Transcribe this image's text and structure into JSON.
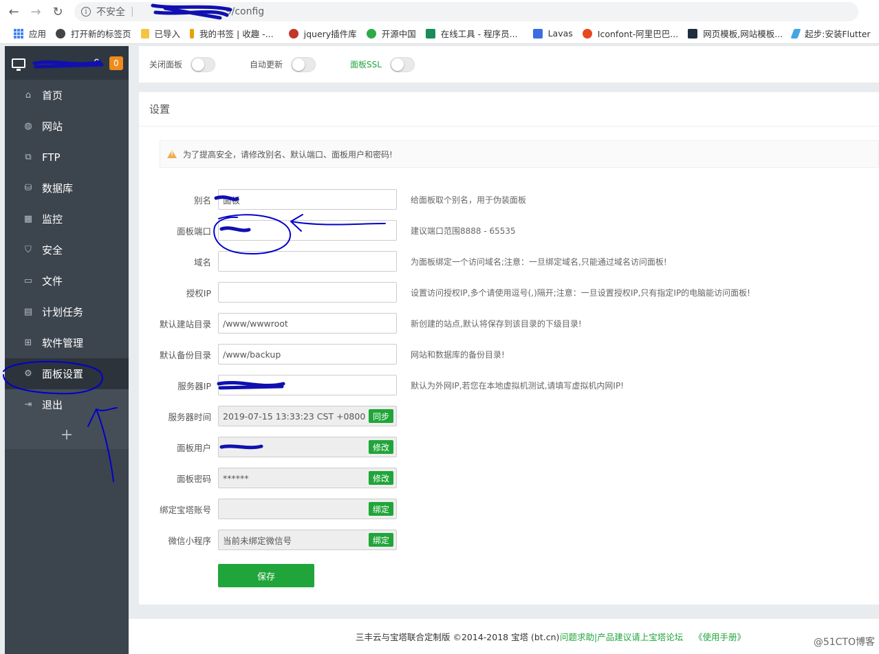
{
  "browser": {
    "security_label": "不安全",
    "separator": "|",
    "path": "9/config",
    "back_label": "←",
    "forward_label": "→",
    "reload_label": "↻",
    "info_label": "i"
  },
  "bookmarks": [
    {
      "label": "应用"
    },
    {
      "label": "打开新的标签页"
    },
    {
      "label": "已导入"
    },
    {
      "label": "我的书签 | 收趣 -..."
    },
    {
      "label": "jquery插件库"
    },
    {
      "label": "开源中国"
    },
    {
      "label": "在线工具 - 程序员..."
    },
    {
      "label": "Lavas"
    },
    {
      "label": "Iconfont-阿里巴巴..."
    },
    {
      "label": "网页模板,网站模板..."
    },
    {
      "label": "起步:安装Flutter"
    }
  ],
  "sidebar": {
    "server_suffix": "0",
    "badge": "0",
    "items": [
      {
        "label": "首页",
        "icon": "home-icon",
        "glyph": "⌂"
      },
      {
        "label": "网站",
        "icon": "globe-icon",
        "glyph": "◍"
      },
      {
        "label": "FTP",
        "icon": "ftp-icon",
        "glyph": "⧉"
      },
      {
        "label": "数据库",
        "icon": "database-icon",
        "glyph": "⛁"
      },
      {
        "label": "监控",
        "icon": "monitor-icon",
        "glyph": "▦"
      },
      {
        "label": "安全",
        "icon": "shield-icon",
        "glyph": "⛉"
      },
      {
        "label": "文件",
        "icon": "folder-icon",
        "glyph": "▭"
      },
      {
        "label": "计划任务",
        "icon": "calendar-icon",
        "glyph": "▤"
      },
      {
        "label": "软件管理",
        "icon": "apps-icon",
        "glyph": "⊞"
      },
      {
        "label": "面板设置",
        "icon": "gear-icon",
        "glyph": "⚙"
      },
      {
        "label": "退出",
        "icon": "logout-icon",
        "glyph": "⇥"
      }
    ],
    "add_label": "+"
  },
  "topbar": {
    "close_panel": "关闭面板",
    "auto_update": "自动更新",
    "panel_ssl": "面板SSL"
  },
  "panel": {
    "title": "设置",
    "alert": "为了提高安全，请修改别名、默认端口、面板用户和密码!",
    "alert_mark": "!",
    "rows": [
      {
        "label": "别名",
        "value": "面板",
        "tip": "给面板取个别名，用于伪装面板"
      },
      {
        "label": "面板端口",
        "value": "",
        "tip": "建议端口范围8888 - 65535"
      },
      {
        "label": "域名",
        "value": "",
        "tip": "为面板绑定一个访问域名;注意：一旦绑定域名,只能通过域名访问面板!"
      },
      {
        "label": "授权IP",
        "value": "",
        "tip": "设置访问授权IP,多个请使用逗号(,)隔开;注意：一旦设置授权IP,只有指定IP的电脑能访问面板!"
      },
      {
        "label": "默认建站目录",
        "value": "/www/wwwroot",
        "tip": "新创建的站点,默认将保存到该目录的下级目录!"
      },
      {
        "label": "默认备份目录",
        "value": "/www/backup",
        "tip": "网站和数据库的备份目录!"
      },
      {
        "label": "服务器IP",
        "value": "",
        "tip": "默认为外网IP,若您在本地虚拟机测试,请填写虚拟机内网IP!"
      },
      {
        "label": "服务器时间",
        "value": "2019-07-15 13:33:23 CST +0800",
        "button": "同步"
      },
      {
        "label": "面板用户",
        "value": "",
        "button": "修改"
      },
      {
        "label": "面板密码",
        "value": "******",
        "button": "修改"
      },
      {
        "label": "绑定宝塔账号",
        "value": "",
        "button": "绑定"
      },
      {
        "label": "微信小程序",
        "value": "当前未绑定微信号",
        "button": "绑定"
      }
    ],
    "save": "保存"
  },
  "footer": {
    "copyright": "三丰云与宝塔联合定制版 ©2014-2018 宝塔 (bt.cn)",
    "help": "问题求助|产品建议请上宝塔论坛",
    "manual": "《使用手册》"
  },
  "watermark": "@51CTO博客",
  "colors": {
    "accent_green": "#20a53a",
    "sidebar_bg": "#3c444d",
    "badge_orange": "#ef8b1d",
    "annotation_blue": "#0000cc"
  }
}
